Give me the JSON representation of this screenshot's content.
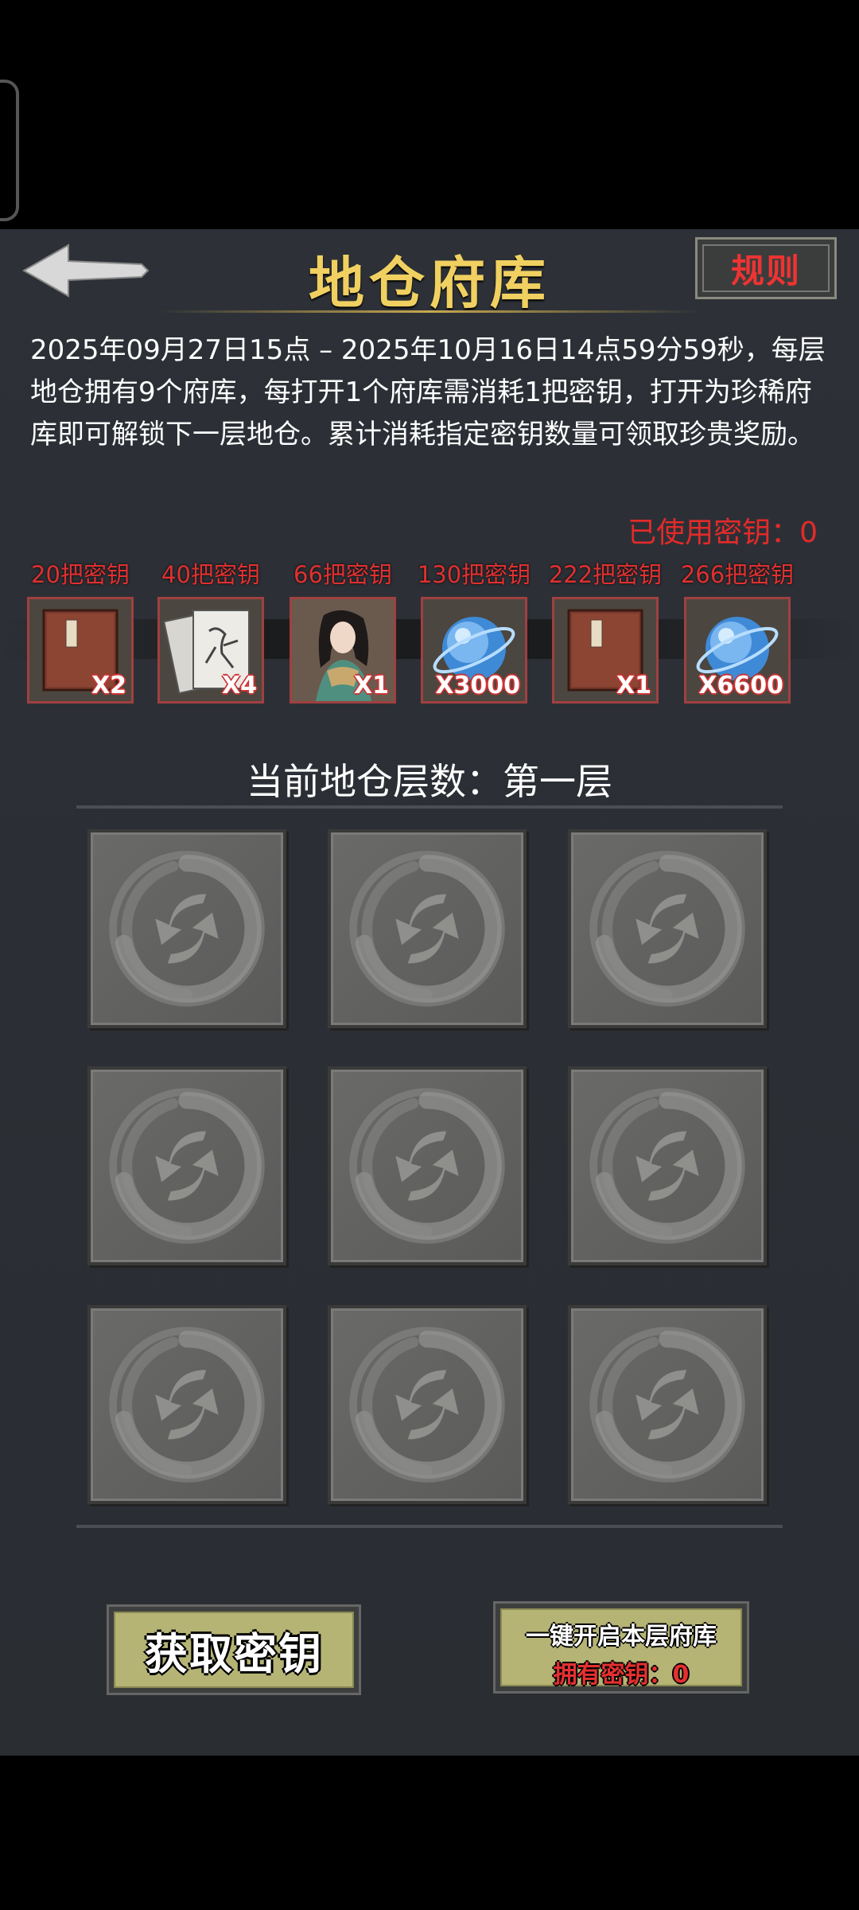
{
  "header": {
    "title": "地仓府库",
    "rules_label": "规则"
  },
  "description": "2025年09月27日15点 – 2025年10月16日14点59分59秒，每层地仓拥有9个府库，每打开1个府库需消耗1把密钥，打开为珍稀府库即可解锁下一层地仓。累计消耗指定密钥数量可领取珍贵奖励。",
  "used_keys": "已使用密钥：0",
  "rewards": [
    {
      "label": "20把密钥",
      "qty": "X2",
      "icon": "book-icon"
    },
    {
      "label": "40把密钥",
      "qty": "X4",
      "icon": "scroll-cards-icon"
    },
    {
      "label": "66把密钥",
      "qty": "X1",
      "icon": "character-portrait-icon"
    },
    {
      "label": "130把密钥",
      "qty": "X3000",
      "icon": "blue-orb-icon"
    },
    {
      "label": "222把密钥",
      "qty": "X1",
      "icon": "book-icon"
    },
    {
      "label": "266把密钥",
      "qty": "X6600",
      "icon": "blue-orb-icon"
    }
  ],
  "floor_label": "当前地仓层数：第一层",
  "vaults": [
    {
      "state": "locked"
    },
    {
      "state": "locked"
    },
    {
      "state": "locked"
    },
    {
      "state": "locked"
    },
    {
      "state": "locked"
    },
    {
      "state": "locked"
    },
    {
      "state": "locked"
    },
    {
      "state": "locked"
    },
    {
      "state": "locked"
    }
  ],
  "buttons": {
    "get_keys": "获取密钥",
    "open_all": "一键开启本层府库",
    "owned_keys": "拥有密钥：0"
  },
  "colors": {
    "title_gold": "#f0d060",
    "accent_red": "#e32a2a",
    "button_olive": "#b5b475",
    "panel_bg": "#2d3137"
  }
}
